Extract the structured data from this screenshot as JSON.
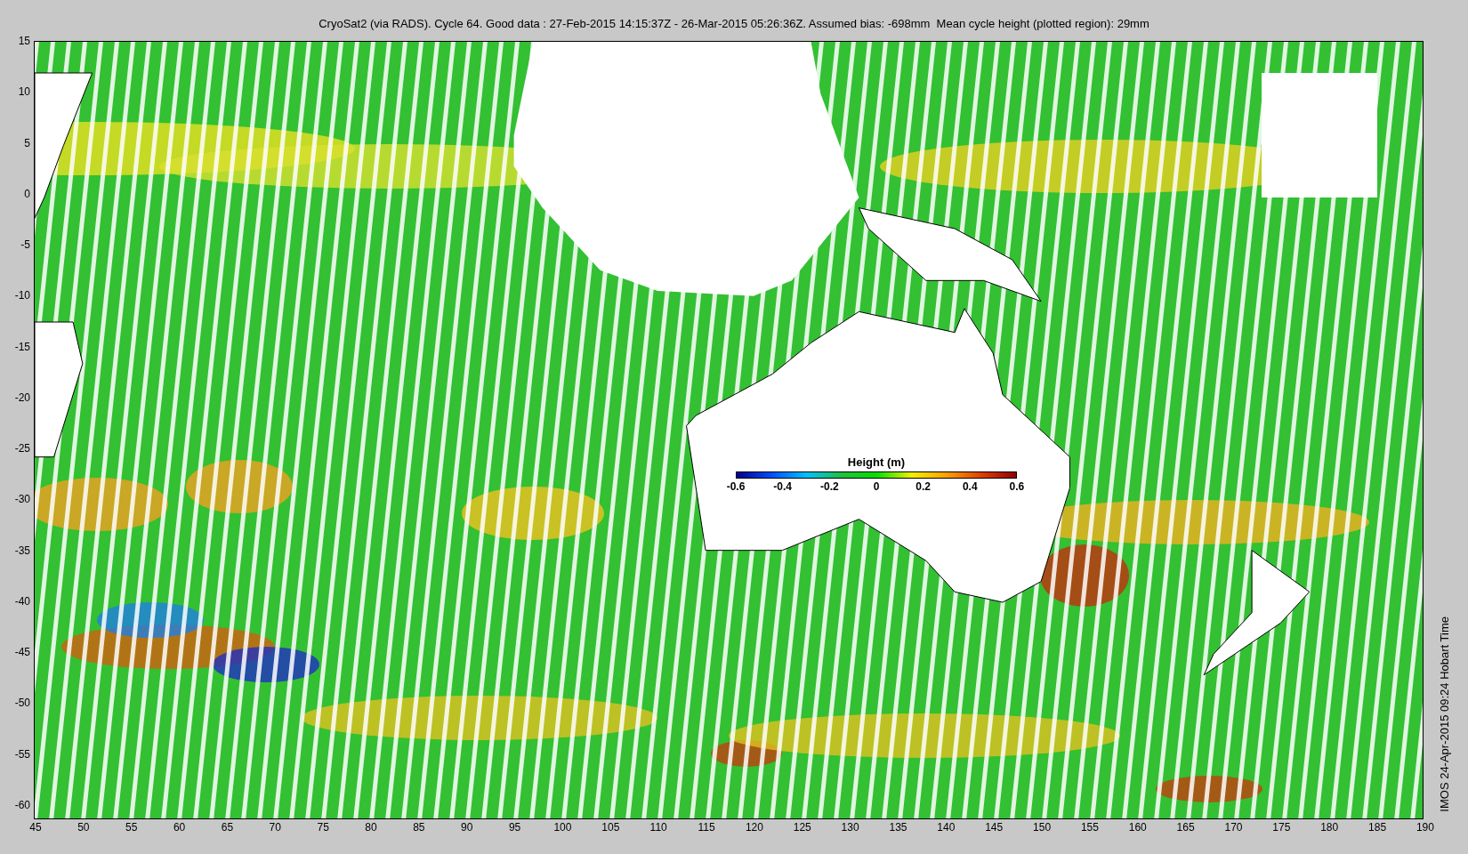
{
  "title": "CryoSat2 (via RADS). Cycle 64. Good data : 27-Feb-2015 14:15:37Z - 26-Mar-2015 05:26:36Z. Assumed bias: -698mm  Mean cycle height (plotted region): 29mm",
  "y_axis": {
    "ticks": [
      "15",
      "10",
      "5",
      "0",
      "-5",
      "-10",
      "-15",
      "-20",
      "-25",
      "-30",
      "-35",
      "-40",
      "-45",
      "-50",
      "-55",
      "-60"
    ]
  },
  "x_axis": {
    "ticks": [
      "45",
      "50",
      "55",
      "60",
      "65",
      "70",
      "75",
      "80",
      "85",
      "90",
      "95",
      "100",
      "105",
      "110",
      "115",
      "120",
      "125",
      "130",
      "135",
      "140",
      "145",
      "150",
      "155",
      "160",
      "165",
      "170",
      "175",
      "180",
      "185",
      "190"
    ]
  },
  "colorbar": {
    "title": "Height (m)",
    "ticks": [
      "-0.6",
      "-0.4",
      "-0.2",
      "0",
      "0.2",
      "0.4",
      "0.6"
    ]
  },
  "footer": "IMOS 24-Apr-2015 09:24 Hobart Time"
}
